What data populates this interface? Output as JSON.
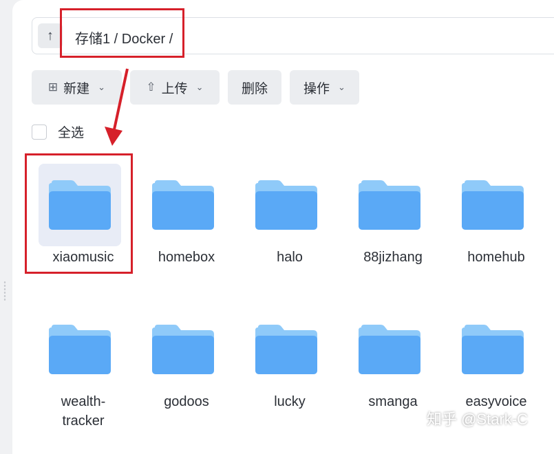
{
  "path": {
    "up_icon": "arrow-up-icon",
    "up_glyph": "↑",
    "text": "存储1 / Docker /"
  },
  "toolbar": {
    "new_label": "新建",
    "new_icon": "⊞",
    "upload_label": "上传",
    "upload_icon": "⇧",
    "delete_label": "删除",
    "actions_label": "操作",
    "chevron": "⌄"
  },
  "select_all": {
    "label": "全选",
    "checked": false
  },
  "folders": [
    {
      "name": "xiaomusic",
      "selected": true
    },
    {
      "name": "homebox",
      "selected": false
    },
    {
      "name": "halo",
      "selected": false
    },
    {
      "name": "88jizhang",
      "selected": false
    },
    {
      "name": "homehub",
      "selected": false
    },
    {
      "name": "wealth-",
      "name_line2": "tracker",
      "selected": false
    },
    {
      "name": "godoos",
      "selected": false
    },
    {
      "name": "lucky",
      "selected": false
    },
    {
      "name": "smanga",
      "selected": false
    },
    {
      "name": "easyvoice",
      "selected": false
    }
  ],
  "watermark": "知乎 @Stark-C",
  "colors": {
    "annotation": "#d6202a",
    "folder_front": "#5aa9f6",
    "folder_back": "#8fcaf9"
  }
}
